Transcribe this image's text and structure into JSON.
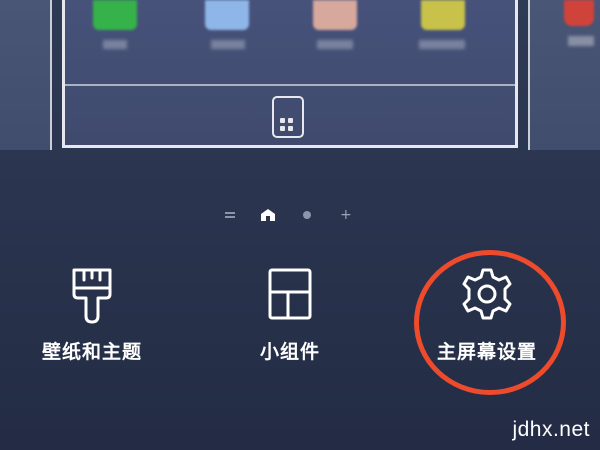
{
  "page_indicator": {
    "menu_icon": "menu-lines-icon",
    "home_icon": "home-icon",
    "page_dot_icon": "dot-icon",
    "add_symbol": "+"
  },
  "tools": [
    {
      "label": "壁纸和主题",
      "icon": "paintbrush-icon"
    },
    {
      "label": "小组件",
      "icon": "widget-grid-icon"
    },
    {
      "label": "主屏幕设置",
      "icon": "gear-icon"
    }
  ],
  "colors": {
    "background": "#2a344e",
    "highlight": "#ee4b2c",
    "text": "#ffffff",
    "card_border": "#e6e8ee"
  },
  "watermark": "jdhx.net"
}
